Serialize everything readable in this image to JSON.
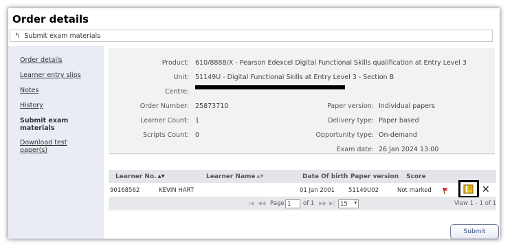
{
  "page": {
    "title": "Order details"
  },
  "back_link": {
    "label": "Submit exam materials"
  },
  "sidebar": {
    "items": [
      {
        "label": "Order details"
      },
      {
        "label": "Learner entry slips"
      },
      {
        "label": "Notes"
      },
      {
        "label": "History"
      },
      {
        "label": "Submit exam materials"
      },
      {
        "label": "Download test paper(s)"
      }
    ]
  },
  "order": {
    "product_label": "Product:",
    "product_value": "610/8888/X - Pearson Edexcel Digital Functional Skills qualification at Entry Level 3",
    "unit_label": "Unit:",
    "unit_value": "51149U - Digital Functional Skills at Entry Level 3 - Section B",
    "centre_label": "Centre:",
    "order_number_label": "Order Number:",
    "order_number_value": "25873710",
    "learner_count_label": "Learner Count:",
    "learner_count_value": "1",
    "scripts_count_label": "Scripts Count:",
    "scripts_count_value": "0",
    "paper_version_label": "Paper version:",
    "paper_version_value": "Individual papers",
    "delivery_type_label": "Delivery type:",
    "delivery_type_value": "Paper based",
    "opportunity_type_label": "Opportunity type:",
    "opportunity_type_value": "On-demand",
    "exam_date_label": "Exam date:",
    "exam_date_value": "26 Jan 2024 13:00"
  },
  "table": {
    "columns": {
      "learner_no": "Learner No.",
      "learner_name": "Learner Name",
      "dob": "Date Of birth",
      "paper_version": "Paper version",
      "score": "Score"
    },
    "rows": [
      {
        "learner_no": "90168562",
        "learner_name": "KEVIN HART",
        "dob": "01 Jan 2001",
        "paper_version": "51149U02",
        "score": "Not marked"
      }
    ],
    "pager": {
      "page_label": "Page",
      "page_value": "1",
      "of_label": "of 1",
      "rows_per_page": "15",
      "view_count": "View 1 - 1 of 1"
    }
  },
  "actions": {
    "submit_label": "Submit"
  },
  "icons": {
    "back": "return-arrow-icon",
    "flag": "flag-icon",
    "book": "book-icon",
    "close": "close-icon"
  },
  "colors": {
    "sidebar_bg": "#e9ecf5",
    "panel_bg": "#f1f2f4",
    "header_bg": "#e3e5ea",
    "flag_red": "#cc2222",
    "book_yellow": "#f2c21b"
  }
}
